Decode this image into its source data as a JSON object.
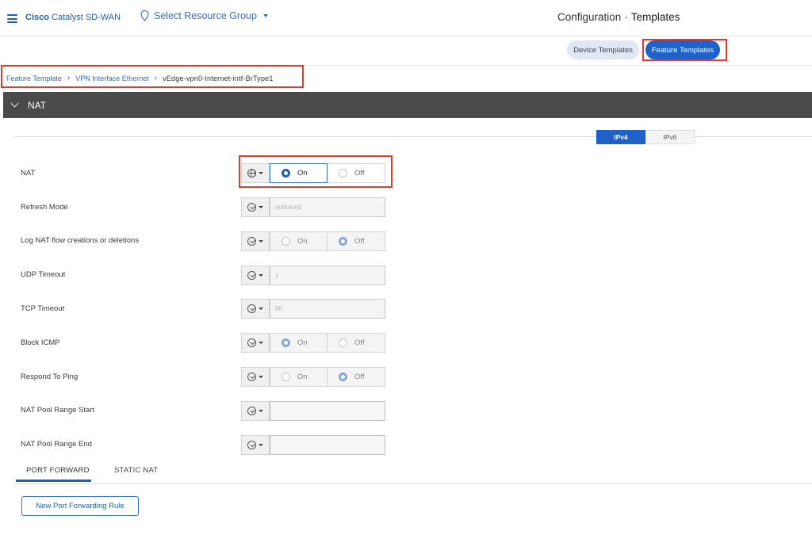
{
  "header": {
    "brand_bold": "Cisco",
    "brand_rest": "Catalyst SD-WAN",
    "resource_group": "Select Resource Group",
    "title_section": "Configuration",
    "title_separator": "·",
    "title_page": "Templates"
  },
  "template_tabs": [
    {
      "label": "Device Templates",
      "active": false
    },
    {
      "label": "Feature Templates",
      "active": true
    }
  ],
  "breadcrumb": {
    "items": [
      "Feature Template",
      "VPN Interface Ethernet"
    ],
    "current": "vEdge-vpn0-Internet-intf-BrType1"
  },
  "section": {
    "title": "NAT",
    "ip_tabs": [
      {
        "label": "IPv4",
        "active": true
      },
      {
        "label": "IPv6",
        "active": false
      }
    ]
  },
  "form": {
    "nat": {
      "label": "NAT",
      "scope_icon": "globe-icon",
      "on_label": "On",
      "off_label": "Off",
      "selected": "On"
    },
    "refresh_mode": {
      "label": "Refresh Mode",
      "scope_icon": "check-circle-icon",
      "value": "outbound"
    },
    "log_nat": {
      "label": "Log NAT flow creations or deletions",
      "scope_icon": "check-circle-icon",
      "on_label": "On",
      "off_label": "Off",
      "selected": "Off"
    },
    "udp_timeout": {
      "label": "UDP Timeout",
      "scope_icon": "check-circle-icon",
      "value": "1"
    },
    "tcp_timeout": {
      "label": "TCP Timeout",
      "scope_icon": "check-circle-icon",
      "value": "60"
    },
    "block_icmp": {
      "label": "Block ICMP",
      "scope_icon": "check-circle-icon",
      "on_label": "On",
      "off_label": "Off",
      "selected": "On"
    },
    "respond_ping": {
      "label": "Respond To Ping",
      "scope_icon": "check-circle-icon",
      "on_label": "On",
      "off_label": "Off",
      "selected": "Off"
    },
    "pool_start": {
      "label": "NAT Pool Range Start",
      "scope_icon": "check-circle-icon",
      "value": ""
    },
    "pool_end": {
      "label": "NAT Pool Range End",
      "scope_icon": "check-circle-icon",
      "value": ""
    }
  },
  "sub_tabs": [
    {
      "label": "PORT FORWARD",
      "active": true
    },
    {
      "label": "STATIC NAT",
      "active": false
    }
  ],
  "new_rule_button": "New Port Forwarding Rule",
  "colors": {
    "accent": "#1e62c9",
    "highlight": "#e23b2b",
    "section_header": "#4a4a4a"
  }
}
